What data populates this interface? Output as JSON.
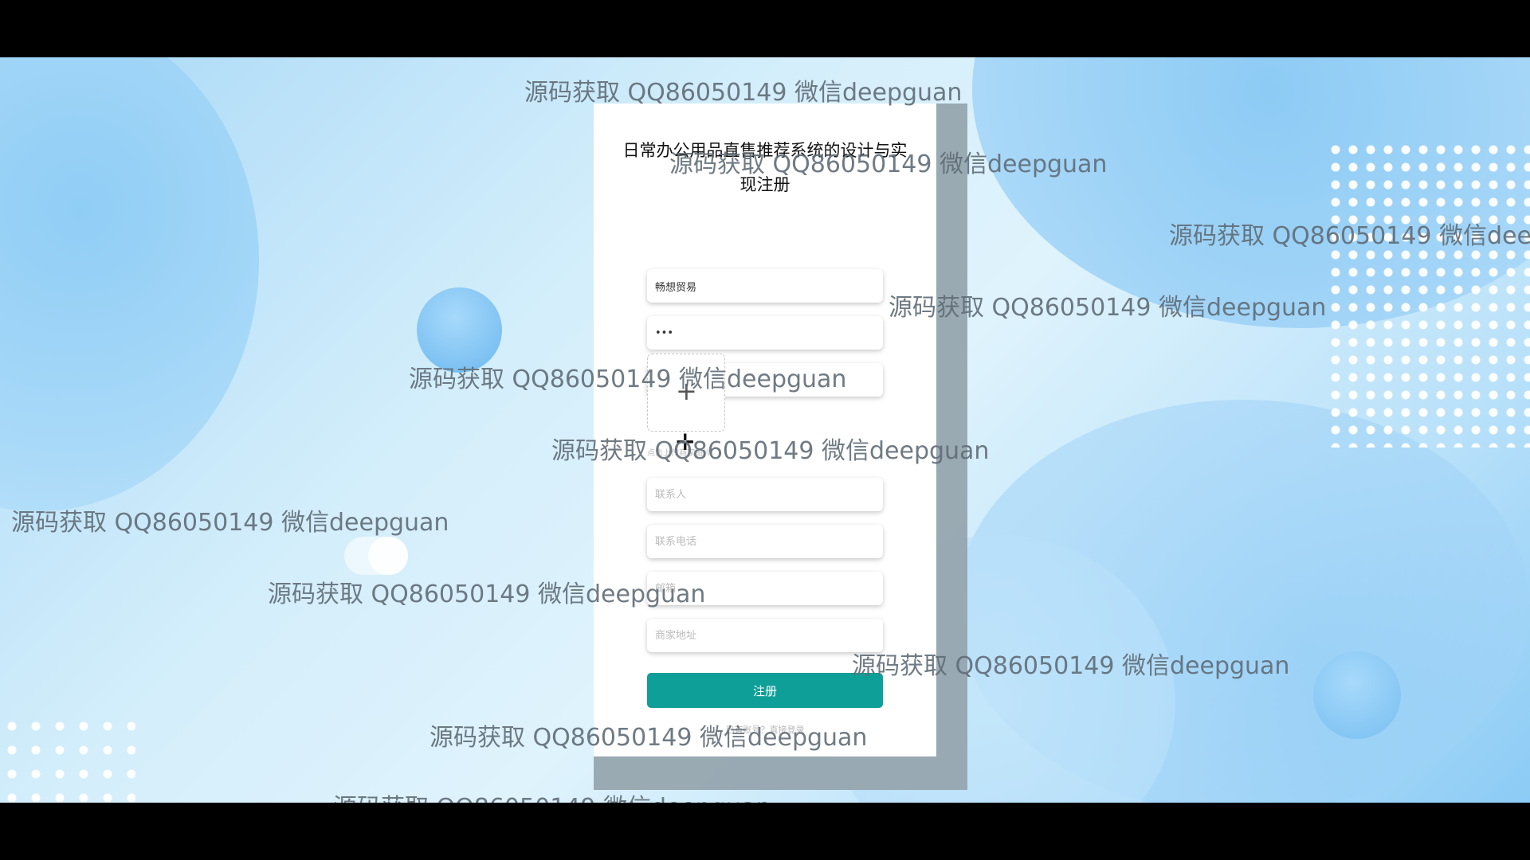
{
  "form": {
    "title": "日常办公用品直售推荐系统的设计与实现注册",
    "username_value": "畅想贸易",
    "password_value": "•••",
    "confirm_password_value": "•••",
    "upload_plus": "+",
    "upload_tip": "点击上传商家图片",
    "contact_placeholder": "联系人",
    "phone_placeholder": "联系电话",
    "email_placeholder": "邮箱",
    "address_placeholder": "商家地址",
    "submit_label": "注册",
    "login_link": "已有账号？直接登录"
  },
  "watermark": {
    "text": "源码获取 QQ86050149 微信deepguan"
  },
  "colors": {
    "primary": "#0e9f98",
    "background_light": "#dff3fc",
    "background_blue": "#8ccbf5"
  }
}
